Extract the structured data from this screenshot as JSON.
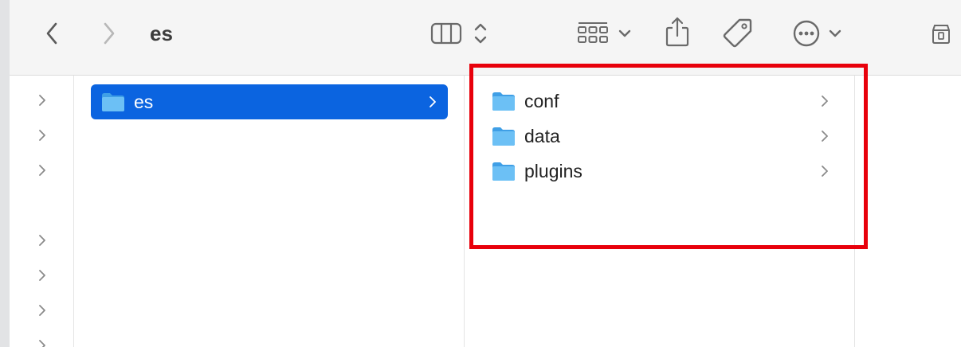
{
  "window": {
    "title": "es"
  },
  "toolbar": {
    "back_icon": "chevron-left-icon",
    "forward_icon": "chevron-right-icon",
    "view_icon": "column-view-icon",
    "group_icon": "grid-group-icon",
    "share_icon": "share-icon",
    "tag_icon": "tag-icon",
    "more_icon": "ellipsis-circle-icon",
    "extra_icon": "storage-icon"
  },
  "browser": {
    "column1": {
      "items": [
        {
          "label": "es",
          "selected": true,
          "icon": "folder-icon"
        }
      ]
    },
    "column2": {
      "items": [
        {
          "label": "conf",
          "icon": "folder-icon"
        },
        {
          "label": "data",
          "icon": "folder-icon"
        },
        {
          "label": "plugins",
          "icon": "folder-icon"
        }
      ]
    }
  },
  "colors": {
    "selection": "#0b64e0",
    "highlight_box": "#e8000b",
    "folder": "#5ab4ef"
  }
}
